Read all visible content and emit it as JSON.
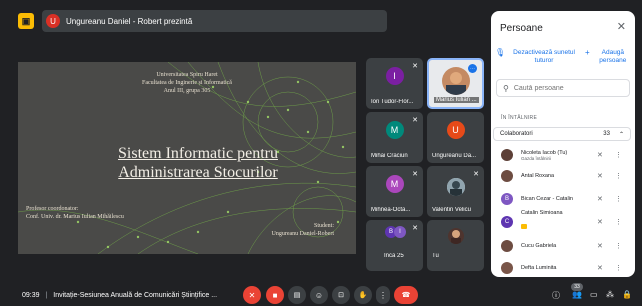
{
  "topbar": {
    "presenter_initial": "U",
    "presenter_text": "Ungureanu Daniel - Robert prezintă"
  },
  "slide": {
    "uni_line1": "Universitatea Spiru Haret",
    "uni_line2": "Facultatea de Inginerie și Informatică",
    "uni_line3": "Anul III, grupa 305",
    "title_line1": "Sistem Informatic pentru",
    "title_line2": "Administrarea Stocurilor",
    "coord_line1": "Profesor coordonator:",
    "coord_line2": "Conf. Univ. dr. Marius Iulian Mihăilescu",
    "student_line1": "Student:",
    "student_line2": "Ungureanu Daniel-Robert"
  },
  "tiles": [
    {
      "name": "Ion Tudor-Flor...",
      "initial": "I",
      "color": "#7b1fa2"
    },
    {
      "name": "Marius Iulian ...",
      "initial": "",
      "color": ""
    },
    {
      "name": "Mihai Craciun",
      "initial": "M",
      "color": "#00897b"
    },
    {
      "name": "Ungureanu Da...",
      "initial": "U",
      "color": "#e64a19"
    },
    {
      "name": "Mihnea-Octa...",
      "initial": "M",
      "color": "#ab47bc"
    },
    {
      "name": "Valentin Velicu",
      "initial": "",
      "color": ""
    },
    {
      "name": "Încă 25",
      "initial": "B",
      "initial2": "I",
      "color": "#5e35b1"
    },
    {
      "name": "Tu",
      "initial": "",
      "color": ""
    }
  ],
  "panel": {
    "title": "Persoane",
    "mute_label": "Dezactivează sunetul tuturor",
    "add_label": "Adaugă persoane",
    "search_placeholder": "Caută persoane",
    "section": "ÎN ÎNTÂLNIRE",
    "group_label": "Colaboratori",
    "group_count": "33",
    "people": [
      {
        "name": "Nicoleta Iacob (Tu)",
        "sub": "Gazda întâlnirii",
        "initial": "",
        "color": "#5d4037"
      },
      {
        "name": "Antal Roxana",
        "sub": "",
        "initial": "",
        "color": "#6d4c41"
      },
      {
        "name": "Bican Cezar - Catalin",
        "sub": "",
        "initial": "B",
        "color": "#7e57c2"
      },
      {
        "name": "Catalin Simioana",
        "sub": "",
        "initial": "C",
        "color": "#5e35b1"
      },
      {
        "name": "Cucu Gabriela",
        "sub": "",
        "initial": "",
        "color": "#6d4c41"
      },
      {
        "name": "Defta Luminita",
        "sub": "",
        "initial": "",
        "color": "#795548"
      }
    ]
  },
  "bottombar": {
    "time": "09:39",
    "separator": "|",
    "meeting_title": "Invitație-Sesiunea Anuală de Comunicări Științifice ...",
    "participants_badge": "33"
  }
}
